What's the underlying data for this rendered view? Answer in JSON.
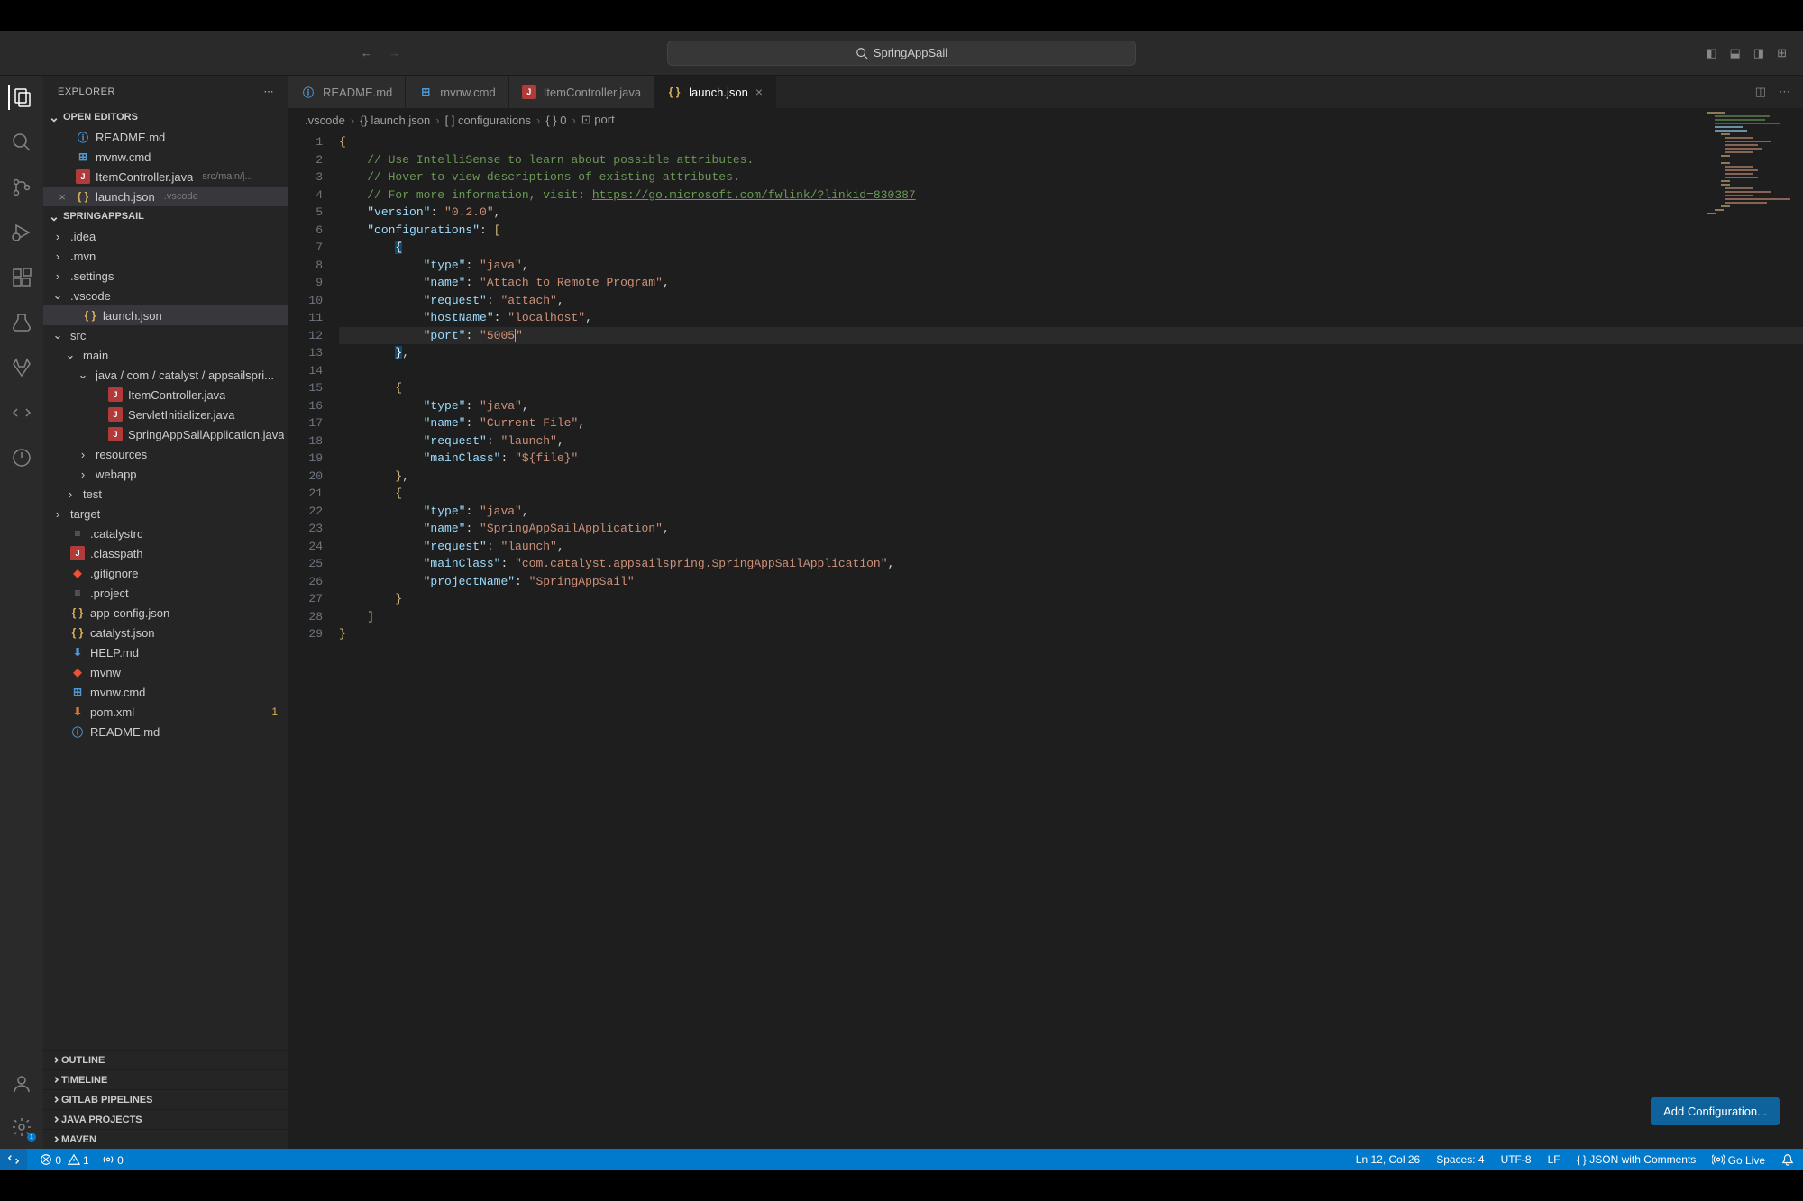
{
  "titlebar": {
    "search": "SpringAppSail"
  },
  "sidebar": {
    "title": "EXPLORER",
    "open_editors_label": "OPEN EDITORS",
    "open_editors": [
      {
        "icon": "readme",
        "label": "README.md"
      },
      {
        "icon": "win",
        "label": "mvnw.cmd"
      },
      {
        "icon": "java",
        "label": "ItemController.java",
        "desc": "src/main/j..."
      },
      {
        "icon": "json",
        "label": "launch.json",
        "desc": ".vscode",
        "active": true,
        "close": true
      }
    ],
    "project_label": "SPRINGAPPSAIL",
    "tree": [
      {
        "d": 0,
        "t": "folder",
        "open": false,
        "label": ".idea"
      },
      {
        "d": 0,
        "t": "folder",
        "open": false,
        "label": ".mvn"
      },
      {
        "d": 0,
        "t": "folder",
        "open": false,
        "label": ".settings"
      },
      {
        "d": 0,
        "t": "folder",
        "open": true,
        "label": ".vscode"
      },
      {
        "d": 1,
        "t": "file",
        "icon": "json",
        "label": "launch.json",
        "active": true
      },
      {
        "d": 0,
        "t": "folder",
        "open": true,
        "label": "src"
      },
      {
        "d": 1,
        "t": "folder",
        "open": true,
        "label": "main"
      },
      {
        "d": 2,
        "t": "path",
        "open": true,
        "label": "java / com / catalyst / appsailspri..."
      },
      {
        "d": 3,
        "t": "file",
        "icon": "java",
        "label": "ItemController.java"
      },
      {
        "d": 3,
        "t": "file",
        "icon": "java",
        "label": "ServletInitializer.java"
      },
      {
        "d": 3,
        "t": "file",
        "icon": "java",
        "label": "SpringAppSailApplication.java"
      },
      {
        "d": 2,
        "t": "folder",
        "open": false,
        "label": "resources"
      },
      {
        "d": 2,
        "t": "folder",
        "open": false,
        "label": "webapp"
      },
      {
        "d": 1,
        "t": "folder",
        "open": false,
        "label": "test"
      },
      {
        "d": 0,
        "t": "folder",
        "open": false,
        "label": "target"
      },
      {
        "d": 0,
        "t": "file",
        "icon": "txt",
        "label": ".catalystrc"
      },
      {
        "d": 0,
        "t": "file",
        "icon": "java",
        "label": ".classpath"
      },
      {
        "d": 0,
        "t": "file",
        "icon": "git",
        "label": ".gitignore"
      },
      {
        "d": 0,
        "t": "file",
        "icon": "txt",
        "label": ".project"
      },
      {
        "d": 0,
        "t": "file",
        "icon": "json",
        "label": "app-config.json"
      },
      {
        "d": 0,
        "t": "file",
        "icon": "json",
        "label": "catalyst.json"
      },
      {
        "d": 0,
        "t": "file",
        "icon": "md",
        "label": "HELP.md"
      },
      {
        "d": 0,
        "t": "file",
        "icon": "git",
        "label": "mvnw"
      },
      {
        "d": 0,
        "t": "file",
        "icon": "win",
        "label": "mvnw.cmd"
      },
      {
        "d": 0,
        "t": "file",
        "icon": "xml",
        "label": "pom.xml",
        "badge": "1"
      },
      {
        "d": 0,
        "t": "file",
        "icon": "readme",
        "label": "README.md"
      }
    ],
    "bottom_panels": [
      "OUTLINE",
      "TIMELINE",
      "GITLAB PIPELINES",
      "JAVA PROJECTS",
      "MAVEN"
    ]
  },
  "tabs": [
    {
      "icon": "readme",
      "label": "README.md"
    },
    {
      "icon": "win",
      "label": "mvnw.cmd"
    },
    {
      "icon": "java",
      "label": "ItemController.java"
    },
    {
      "icon": "json",
      "label": "launch.json",
      "active": true,
      "close": true
    }
  ],
  "breadcrumb": [
    ".vscode",
    "{} launch.json",
    "[ ] configurations",
    "{ } 0",
    "⊡ port"
  ],
  "code": {
    "lines": [
      {
        "n": 1,
        "html": "<span class='s-brace'>{</span>"
      },
      {
        "n": 2,
        "html": "    <span class='s-comment'>// Use IntelliSense to learn about possible attributes.</span>"
      },
      {
        "n": 3,
        "html": "    <span class='s-comment'>// Hover to view descriptions of existing attributes.</span>"
      },
      {
        "n": 4,
        "html": "    <span class='s-comment'>// For more information, visit: </span><span class='s-link'>https://go.microsoft.com/fwlink/?linkid=830387</span>"
      },
      {
        "n": 5,
        "html": "    <span class='s-key'>\"version\"</span><span class='s-punc'>: </span><span class='s-str'>\"0.2.0\"</span><span class='s-punc'>,</span>"
      },
      {
        "n": 6,
        "html": "    <span class='s-key'>\"configurations\"</span><span class='s-punc'>: </span><span class='s-brace'>[</span>"
      },
      {
        "n": 7,
        "html": "        <span class='s-brace' style='background:#0d4a6e;color:#fff;'>{</span>"
      },
      {
        "n": 8,
        "html": "            <span class='s-key'>\"type\"</span><span class='s-punc'>: </span><span class='s-str'>\"java\"</span><span class='s-punc'>,</span>"
      },
      {
        "n": 9,
        "html": "            <span class='s-key'>\"name\"</span><span class='s-punc'>: </span><span class='s-str'>\"Attach to Remote Program\"</span><span class='s-punc'>,</span>"
      },
      {
        "n": 10,
        "html": "            <span class='s-key'>\"request\"</span><span class='s-punc'>: </span><span class='s-str'>\"attach\"</span><span class='s-punc'>,</span>"
      },
      {
        "n": 11,
        "html": "            <span class='s-key'>\"hostName\"</span><span class='s-punc'>: </span><span class='s-str'>\"localhost\"</span><span class='s-punc'>,</span>"
      },
      {
        "n": 12,
        "hl": true,
        "html": "            <span class='s-key'>\"port\"</span><span class='s-punc'>: </span><span class='s-str'>\"5005<span style='border-right:1px solid #aeafad'></span>\"</span>"
      },
      {
        "n": 13,
        "html": "        <span class='s-brace' style='background:#0d4a6e;color:#fff;'>}</span><span class='s-punc'>,</span>"
      },
      {
        "n": 14,
        "html": ""
      },
      {
        "n": 15,
        "html": "        <span class='s-brace'>{</span>"
      },
      {
        "n": 16,
        "html": "            <span class='s-key'>\"type\"</span><span class='s-punc'>: </span><span class='s-str'>\"java\"</span><span class='s-punc'>,</span>"
      },
      {
        "n": 17,
        "html": "            <span class='s-key'>\"name\"</span><span class='s-punc'>: </span><span class='s-str'>\"Current File\"</span><span class='s-punc'>,</span>"
      },
      {
        "n": 18,
        "html": "            <span class='s-key'>\"request\"</span><span class='s-punc'>: </span><span class='s-str'>\"launch\"</span><span class='s-punc'>,</span>"
      },
      {
        "n": 19,
        "html": "            <span class='s-key'>\"mainClass\"</span><span class='s-punc'>: </span><span class='s-str'>\"${file}\"</span>"
      },
      {
        "n": 20,
        "html": "        <span class='s-brace'>}</span><span class='s-punc'>,</span>"
      },
      {
        "n": 21,
        "html": "        <span class='s-brace'>{</span>"
      },
      {
        "n": 22,
        "html": "            <span class='s-key'>\"type\"</span><span class='s-punc'>: </span><span class='s-str'>\"java\"</span><span class='s-punc'>,</span>"
      },
      {
        "n": 23,
        "html": "            <span class='s-key'>\"name\"</span><span class='s-punc'>: </span><span class='s-str'>\"SpringAppSailApplication\"</span><span class='s-punc'>,</span>"
      },
      {
        "n": 24,
        "html": "            <span class='s-key'>\"request\"</span><span class='s-punc'>: </span><span class='s-str'>\"launch\"</span><span class='s-punc'>,</span>"
      },
      {
        "n": 25,
        "html": "            <span class='s-key'>\"mainClass\"</span><span class='s-punc'>: </span><span class='s-str'>\"com.catalyst.appsailspring.SpringAppSailApplication\"</span><span class='s-punc'>,</span>"
      },
      {
        "n": 26,
        "html": "            <span class='s-key'>\"projectName\"</span><span class='s-punc'>: </span><span class='s-str'>\"SpringAppSail\"</span>"
      },
      {
        "n": 27,
        "html": "        <span class='s-brace'>}</span>"
      },
      {
        "n": 28,
        "html": "    <span class='s-brace'>]</span>"
      },
      {
        "n": 29,
        "html": "<span class='s-brace'>}</span>"
      }
    ]
  },
  "add_config_btn": "Add Configuration...",
  "statusbar": {
    "errors": "0",
    "warnings": "1",
    "ports": "0",
    "ln_col": "Ln 12, Col 26",
    "spaces": "Spaces: 4",
    "encoding": "UTF-8",
    "eol": "LF",
    "lang": "JSON with Comments",
    "golive": "Go Live"
  }
}
